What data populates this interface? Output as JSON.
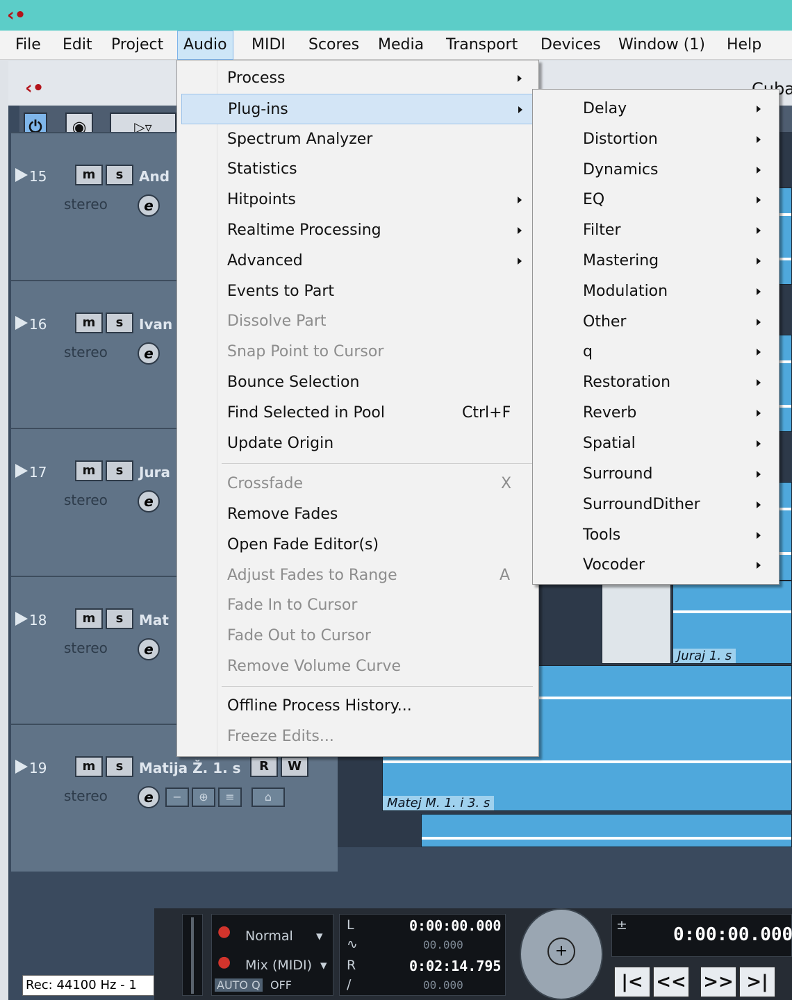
{
  "menubar": {
    "items": [
      "File",
      "Edit",
      "Project",
      "Audio",
      "MIDI",
      "Scores",
      "Media",
      "Transport",
      "Devices",
      "Window (1)",
      "Help"
    ]
  },
  "window": {
    "title_partial": "Cuba"
  },
  "tracks": [
    {
      "number": "15",
      "name": "And",
      "type": "stereo"
    },
    {
      "number": "16",
      "name": "Ivan",
      "type": "stereo"
    },
    {
      "number": "17",
      "name": "Jura",
      "type": "stereo"
    },
    {
      "number": "18",
      "name": "Mat",
      "type": "stereo"
    },
    {
      "number": "19",
      "name": "Matija Ž. 1. s",
      "type": "stereo"
    }
  ],
  "track_buttons": {
    "mute": "m",
    "solo": "s",
    "read": "R",
    "write": "W",
    "edit": "e"
  },
  "clips": {
    "juraj": "Juraj 1. s",
    "matej": "Matej M. 1. i 3. s"
  },
  "audio_menu": {
    "items": [
      {
        "label": "Process",
        "submenu": true
      },
      {
        "label": "Plug-ins",
        "submenu": true,
        "highlighted": true
      },
      {
        "label": "Spectrum Analyzer"
      },
      {
        "label": "Statistics"
      },
      {
        "label": "Hitpoints",
        "submenu": true
      },
      {
        "label": "Realtime Processing",
        "submenu": true
      },
      {
        "label": "Advanced",
        "submenu": true
      },
      {
        "label": "Events to Part"
      },
      {
        "label": "Dissolve Part",
        "disabled": true
      },
      {
        "label": "Snap Point to Cursor",
        "disabled": true
      },
      {
        "label": "Bounce Selection"
      },
      {
        "label": "Find Selected in Pool",
        "shortcut": "Ctrl+F"
      },
      {
        "label": "Update Origin"
      },
      {
        "label": "Crossfade",
        "disabled": true,
        "shortcut": "X"
      },
      {
        "label": "Remove Fades"
      },
      {
        "label": "Open Fade Editor(s)"
      },
      {
        "label": "Adjust Fades to Range",
        "disabled": true,
        "shortcut": "A"
      },
      {
        "label": "Fade In to Cursor",
        "disabled": true
      },
      {
        "label": "Fade Out to Cursor",
        "disabled": true
      },
      {
        "label": "Remove Volume Curve",
        "disabled": true
      },
      {
        "label": "Offline Process History..."
      },
      {
        "label": "Freeze Edits...",
        "disabled": true
      }
    ]
  },
  "plugins_menu": {
    "items": [
      "Delay",
      "Distortion",
      "Dynamics",
      "EQ",
      "Filter",
      "Mastering",
      "Modulation",
      "Other",
      "q",
      "Restoration",
      "Reverb",
      "Spatial",
      "Surround",
      "SurroundDither",
      "Tools",
      "Vocoder"
    ]
  },
  "transport": {
    "record_mode": "Normal",
    "cycle_mode": "Mix (MIDI)",
    "auto_q": "AUTO Q",
    "auto_q_state": "OFF",
    "left_locator": "0:00:00.000",
    "right_locator": "0:02:14.795",
    "left_sub": "00.000",
    "right_sub": "00.000",
    "position": "0:00:00.000",
    "rec_status": "Rec: 44100 Hz - 1",
    "buttons": [
      "|<",
      "<<",
      ">>",
      ">|"
    ]
  },
  "colors": {
    "title_bar": "#5ccdc8",
    "clip": "#4fa8dc",
    "highlight": "#d3e5f6"
  }
}
